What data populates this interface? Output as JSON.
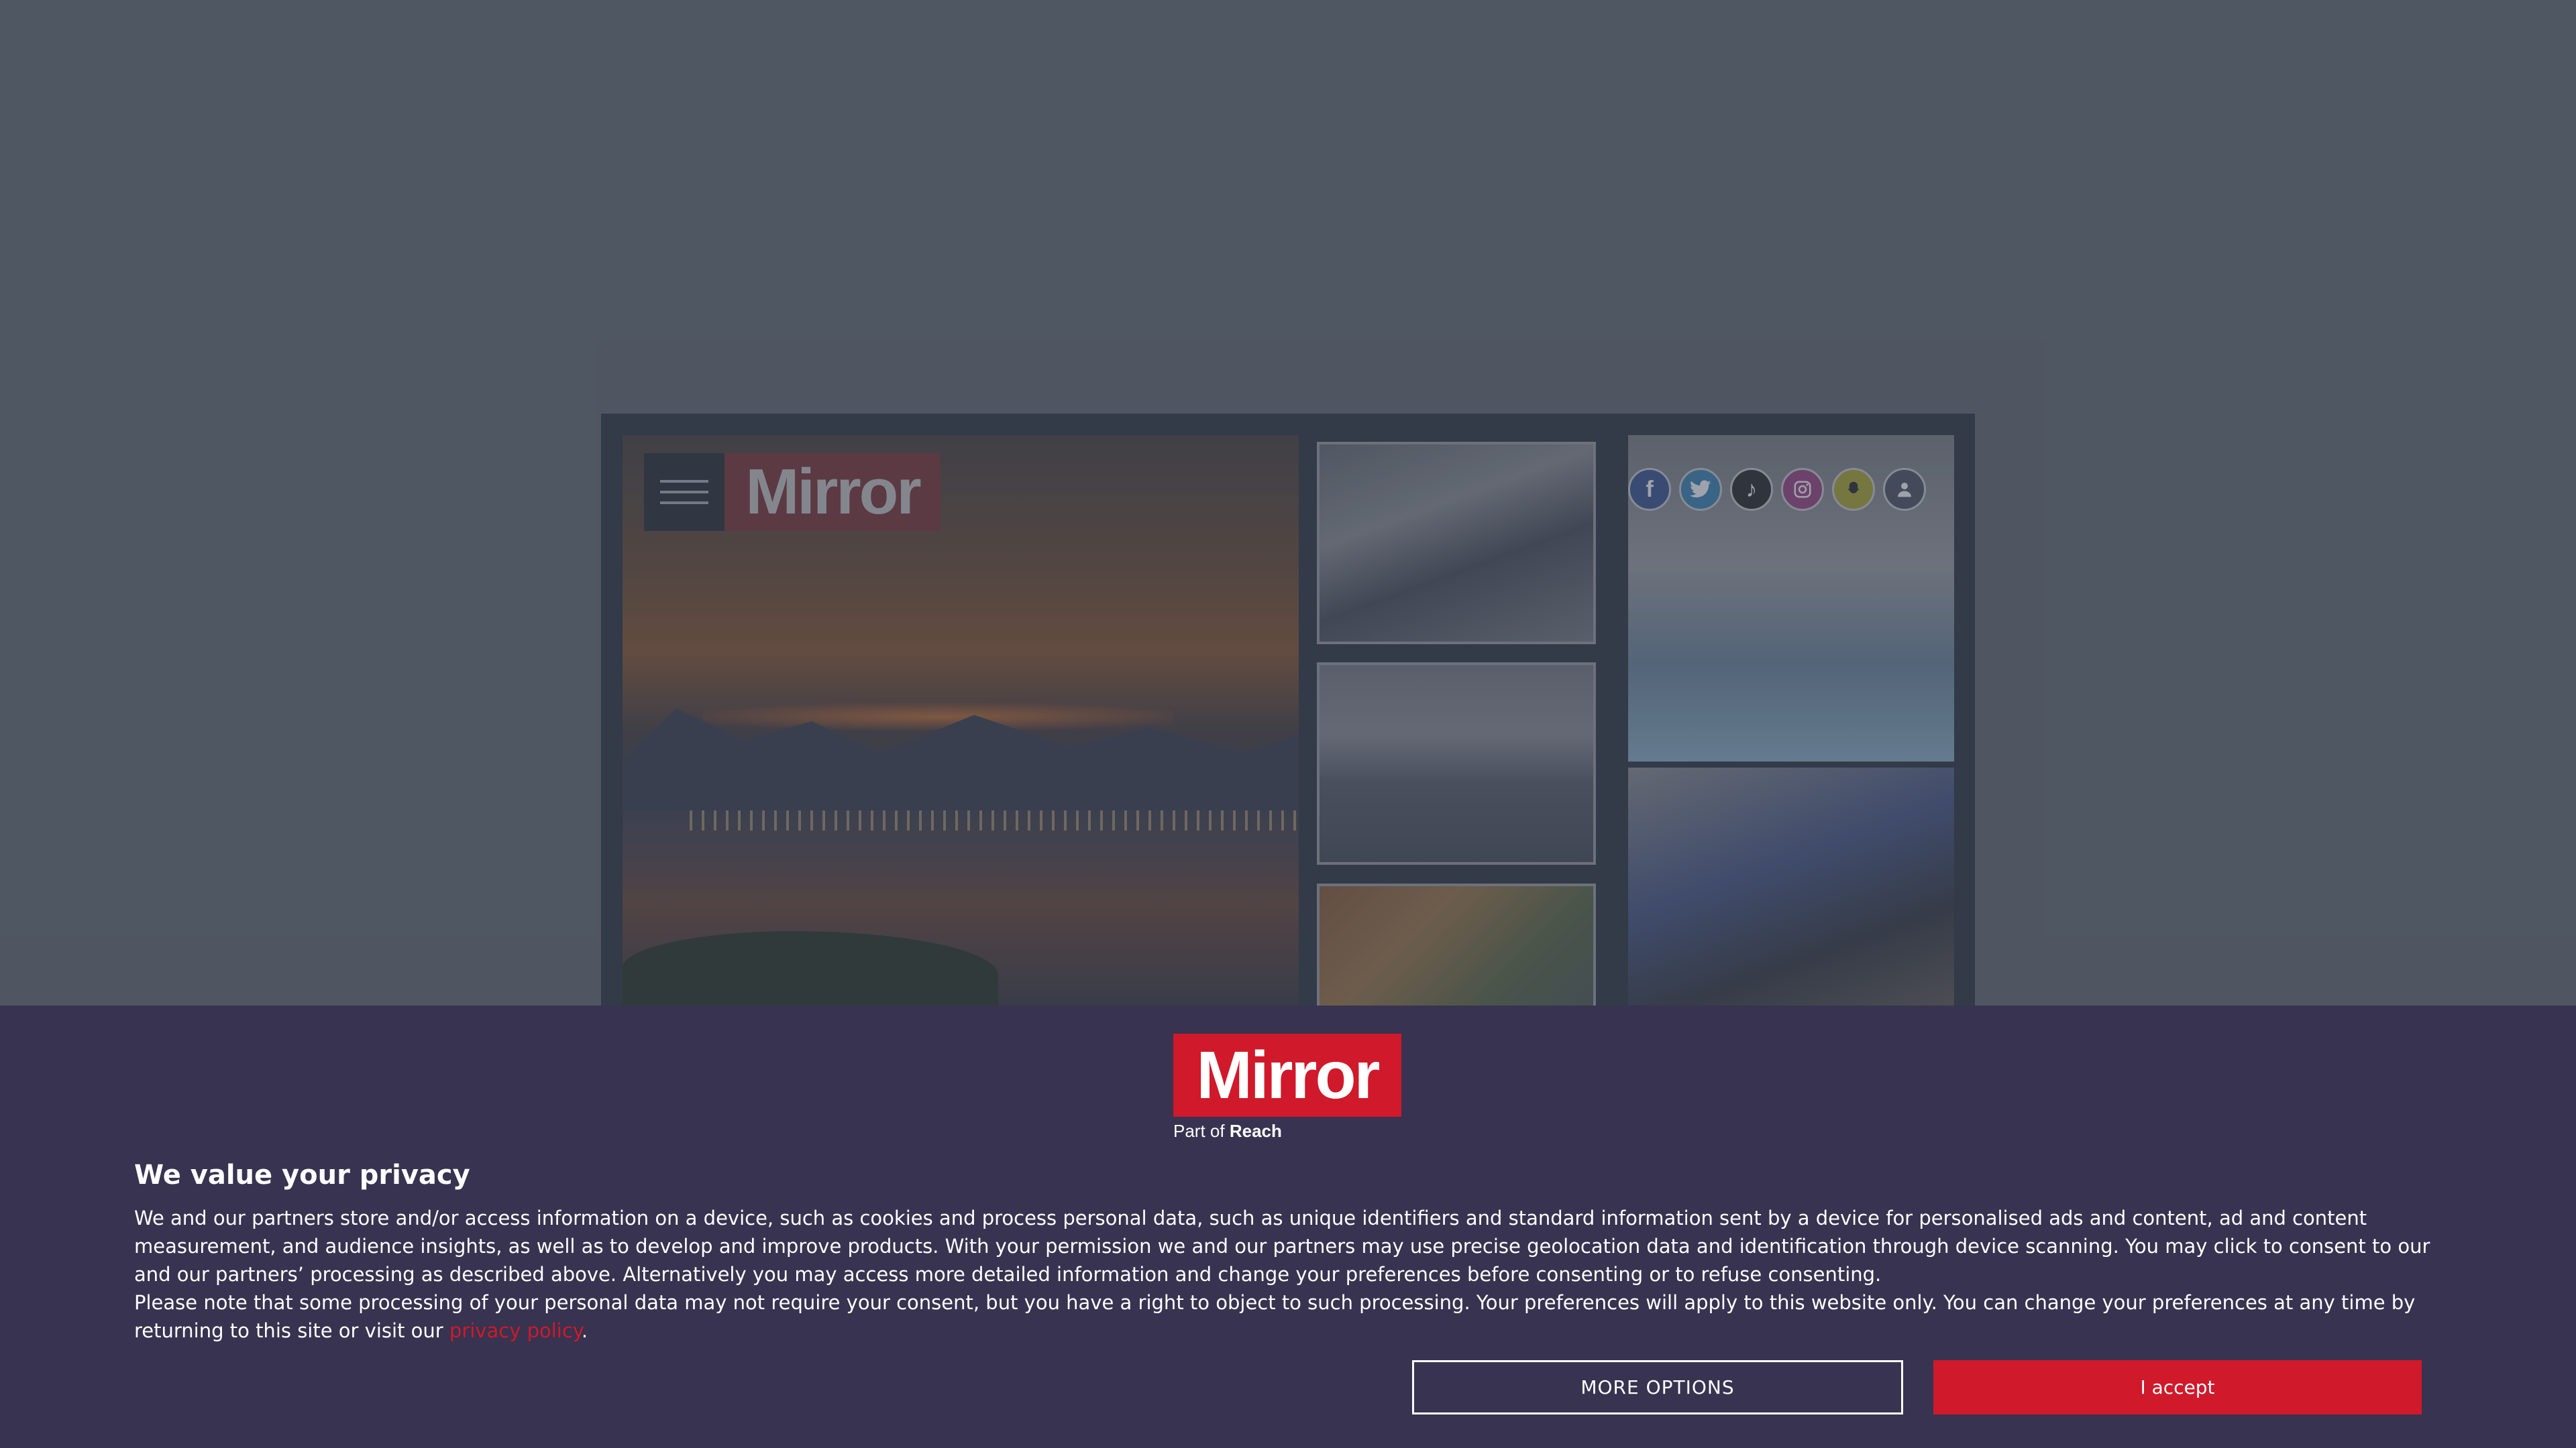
{
  "background_page": {
    "logo_text": "Mirror",
    "social_icons": [
      "facebook-icon",
      "twitter-icon",
      "tiktok-icon",
      "instagram-icon",
      "snapchat-icon",
      "profile-icon"
    ]
  },
  "consent": {
    "logo_text": "Mirror",
    "part_of_prefix": "Part of",
    "part_of_brand": "Reach",
    "title": "We value your privacy",
    "paragraph_1": "We and our partners store and/or access information on a device, such as cookies and process personal data, such as unique identifiers and standard information sent by a device for personalised ads and content, ad and content measurement, and audience insights, as well as to develop and improve products. With your permission we and our partners may use precise geolocation data and identification through device scanning. You may click to consent to our and our partners’ processing as described above. Alternatively you may access more detailed information and change your preferences before consenting or to refuse consenting.",
    "paragraph_2_before_link": "Please note that some processing of your personal data may not require your consent, but you have a right to object to such processing. Your preferences will apply to this website only. You can change your preferences at any time by returning to this site or visit our ",
    "privacy_link_text": "privacy policy",
    "paragraph_2_after_link": ".",
    "more_options_label": "MORE OPTIONS",
    "accept_label": "I accept"
  },
  "colors": {
    "banner_bg": "#373350",
    "brand_red": "#d0192a",
    "page_bg": "#575e69"
  }
}
